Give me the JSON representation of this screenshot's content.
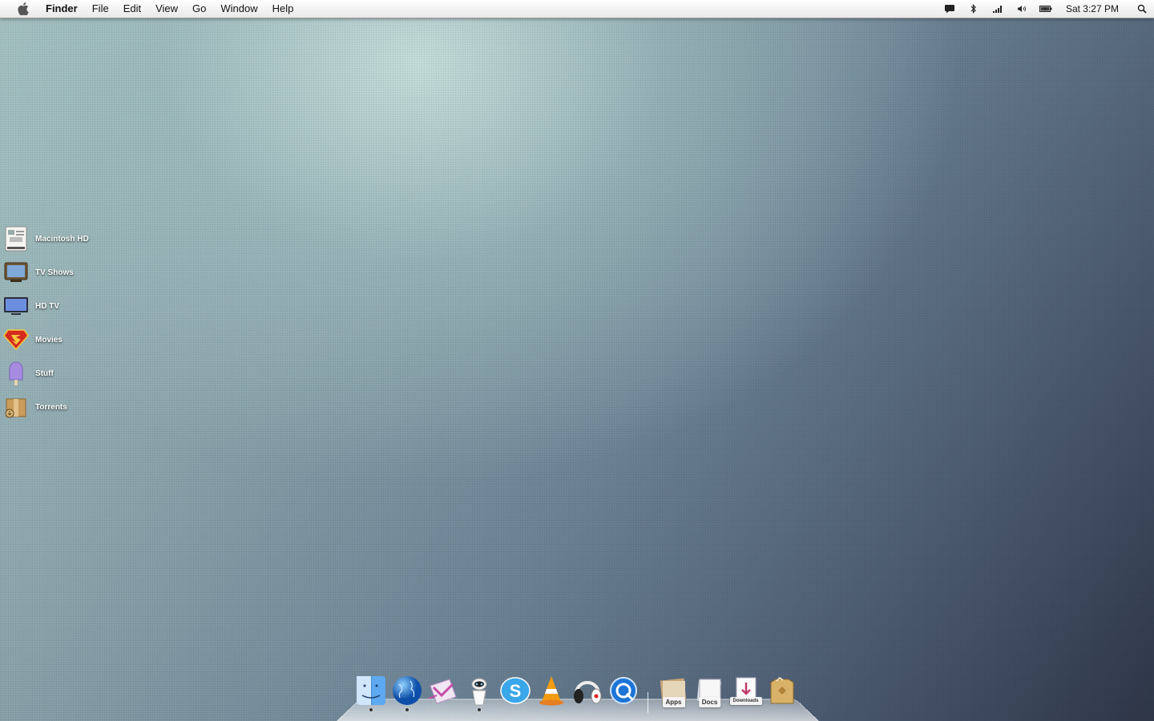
{
  "menubar": {
    "app_name": "Finder",
    "menus": [
      "File",
      "Edit",
      "View",
      "Go",
      "Window",
      "Help"
    ],
    "status_icons": [
      "chat-icon",
      "bluetooth-icon",
      "wifi-icon",
      "volume-icon",
      "battery-icon"
    ],
    "clock": "Sat 3:27 PM",
    "spotlight_icon": "spotlight-icon"
  },
  "desktop": {
    "icons": [
      {
        "label": "Macintosh HD",
        "icon": "hard-drive-icon"
      },
      {
        "label": "TV Shows",
        "icon": "tv-icon"
      },
      {
        "label": "HD TV",
        "icon": "monitor-icon"
      },
      {
        "label": "Movies",
        "icon": "superman-icon"
      },
      {
        "label": "Stuff",
        "icon": "popsicle-icon"
      },
      {
        "label": "Torrents",
        "icon": "box-icon"
      }
    ]
  },
  "dock": {
    "apps": [
      {
        "name": "finder-icon",
        "running": true
      },
      {
        "name": "globe-icon",
        "running": true
      },
      {
        "name": "mail-icon",
        "running": false
      },
      {
        "name": "robot-icon",
        "running": true
      },
      {
        "name": "skype-icon",
        "running": false
      },
      {
        "name": "vlc-icon",
        "running": false
      },
      {
        "name": "headphones-icon",
        "running": false
      },
      {
        "name": "quicktime-icon",
        "running": false
      }
    ],
    "stacks": [
      {
        "label": "Apps"
      },
      {
        "label": "Docs"
      },
      {
        "label": "Downloads"
      }
    ],
    "trash": "trash-icon"
  }
}
